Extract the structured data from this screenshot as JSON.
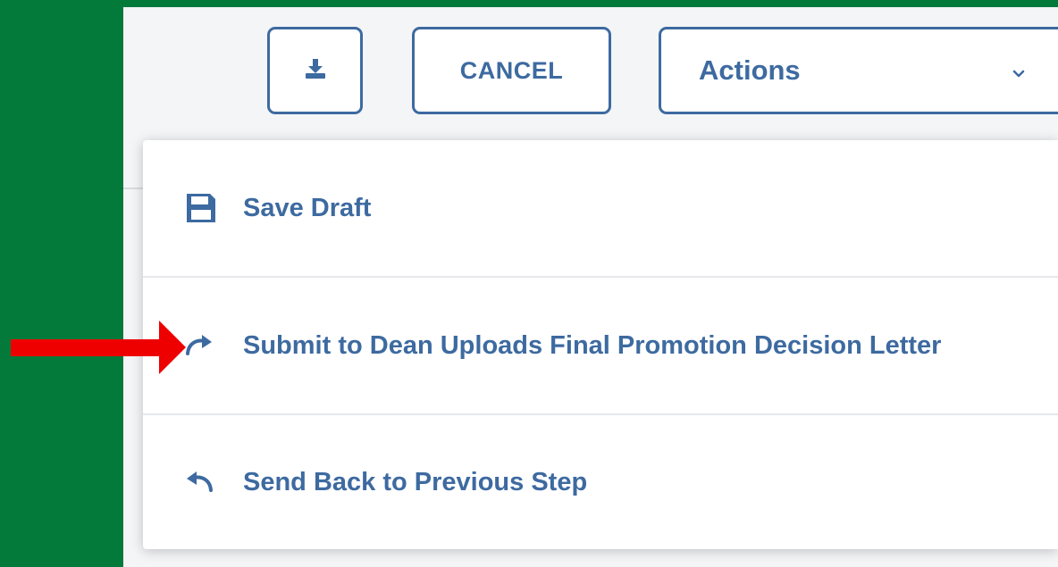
{
  "toolbar": {
    "download_icon": "download-tray-icon",
    "cancel_label": "CANCEL",
    "actions_label": "Actions",
    "actions_chevron_icon": "chevron-down-icon"
  },
  "menu": {
    "items": [
      {
        "label": "Save Draft",
        "icon": "floppy-disk-icon"
      },
      {
        "label": "Submit to Dean Uploads Final Promotion Decision Letter",
        "icon": "redo-arrow-icon"
      },
      {
        "label": "Send Back to Previous Step",
        "icon": "undo-arrow-icon"
      }
    ]
  },
  "annotation": {
    "icon": "red-pointer-arrow-icon"
  },
  "colors": {
    "background_green": "#037a3a",
    "accent_blue": "#3d6aa0",
    "panel": "#f4f5f7",
    "annotation_red": "#ee0000"
  }
}
